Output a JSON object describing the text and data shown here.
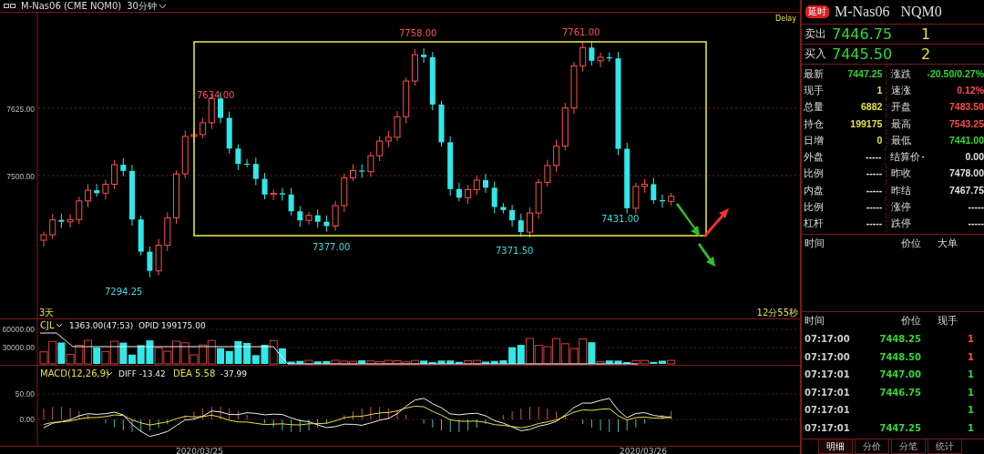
{
  "title_bar": {
    "symbol": "M-Nas06 (CME NQM0)",
    "period": "30分钟"
  },
  "price_chart": {
    "delay": "Delay",
    "yticks": [
      "7625.00",
      "7500.00"
    ],
    "annotations": [
      {
        "text": "7634.00"
      },
      {
        "text": "7758.00"
      },
      {
        "text": "7761.00"
      },
      {
        "text": "7294.25"
      },
      {
        "text": "7377.00"
      },
      {
        "text": "7371.50"
      },
      {
        "text": "7431.00"
      }
    ],
    "range_label": "3天",
    "countdown": "12分55秒"
  },
  "volume": {
    "name": "CJL",
    "value": "1363.00(47:53)",
    "opid": "OPID 199175.00",
    "yticks": [
      "60000.00",
      "30000.00"
    ]
  },
  "macd": {
    "name": "MACD(12,26,9)",
    "diff": "DIFF -13.42",
    "dea": "DEA 5.58",
    "macd": "-37.99",
    "yticks": [
      "50.00",
      "0.00"
    ]
  },
  "dates": [
    "2020/03/25",
    "2020/03/26"
  ],
  "quote": {
    "badge": "延时",
    "symbol": "M-Nas06",
    "code": "NQM0",
    "book": [
      {
        "label": "卖出",
        "price": "7446.75",
        "qty": "1"
      },
      {
        "label": "买入",
        "price": "7445.50",
        "qty": "2"
      }
    ],
    "stats": [
      {
        "left": {
          "label": "最新",
          "value": "7447.25",
          "color": "#33d633"
        },
        "right": {
          "label": "涨跌",
          "value": "-20.50/0.27%",
          "color": "#33d633"
        }
      },
      {
        "left": {
          "label": "现手",
          "value": "1",
          "color": "#e6e04a"
        },
        "right": {
          "label": "速涨",
          "value": "0.12%",
          "color": "#ff4a4a"
        }
      },
      {
        "left": {
          "label": "总量",
          "value": "6882",
          "color": "#e6e04a"
        },
        "right": {
          "label": "开盘",
          "value": "7483.50",
          "color": "#ff4a4a"
        }
      },
      {
        "left": {
          "label": "持仓",
          "value": "199175",
          "color": "#e6e04a"
        },
        "right": {
          "label": "最高",
          "value": "7543.25",
          "color": "#ff4a4a"
        }
      },
      {
        "left": {
          "label": "日增",
          "value": "0",
          "color": "#e6e04a"
        },
        "right": {
          "label": "最低",
          "value": "7441.00",
          "color": "#33d633"
        }
      },
      {
        "left": {
          "label": "外盘",
          "value": "-----",
          "color": "#e0e0e0"
        },
        "right": {
          "label": "结算价",
          "dropdown": true,
          "value": "0.00",
          "color": "#e0e0e0"
        }
      },
      {
        "left": {
          "label": "比例",
          "value": "-----",
          "color": "#e0e0e0"
        },
        "right": {
          "label": "昨收",
          "value": "7478.00",
          "color": "#e0e0e0"
        }
      },
      {
        "left": {
          "label": "内盘",
          "value": "-----",
          "color": "#e0e0e0"
        },
        "right": {
          "label": "昨结",
          "value": "7467.75",
          "color": "#e0e0e0"
        }
      },
      {
        "left": {
          "label": "比例",
          "value": "-----",
          "color": "#e0e0e0"
        },
        "right": {
          "label": "涨停",
          "value": "-----",
          "color": "#e0e0e0"
        }
      },
      {
        "left": {
          "label": "杠杆",
          "value": "-----",
          "color": "#e0e0e0"
        },
        "right": {
          "label": "跌停",
          "value": "-----",
          "color": "#e0e0e0"
        }
      }
    ]
  },
  "big_orders": {
    "columns": [
      "时间",
      "价位",
      "大单"
    ]
  },
  "trades": {
    "columns": [
      "时间",
      "价位",
      "现手"
    ],
    "rows": [
      {
        "time": "07:17:00",
        "price": "7448.25",
        "qty": "1",
        "color": "#ff4a4a"
      },
      {
        "time": "07:17:00",
        "price": "7448.50",
        "qty": "1",
        "color": "#ff4a4a"
      },
      {
        "time": "07:17:01",
        "price": "7447.00",
        "qty": "1",
        "color": "#33d633"
      },
      {
        "time": "07:17:01",
        "price": "7446.75",
        "qty": "1",
        "color": "#33d633"
      },
      {
        "time": "07:17:01",
        "qty": "1",
        "color": "#33d633"
      },
      {
        "time": "07:17:01",
        "price": "7447.25",
        "qty": "1",
        "color": "#33d633"
      }
    ]
  },
  "tabs": [
    {
      "label": "明细",
      "selected": true
    },
    {
      "label": "分价",
      "selected": false
    },
    {
      "label": "分笔",
      "selected": false
    },
    {
      "label": "统计",
      "selected": false
    }
  ]
}
